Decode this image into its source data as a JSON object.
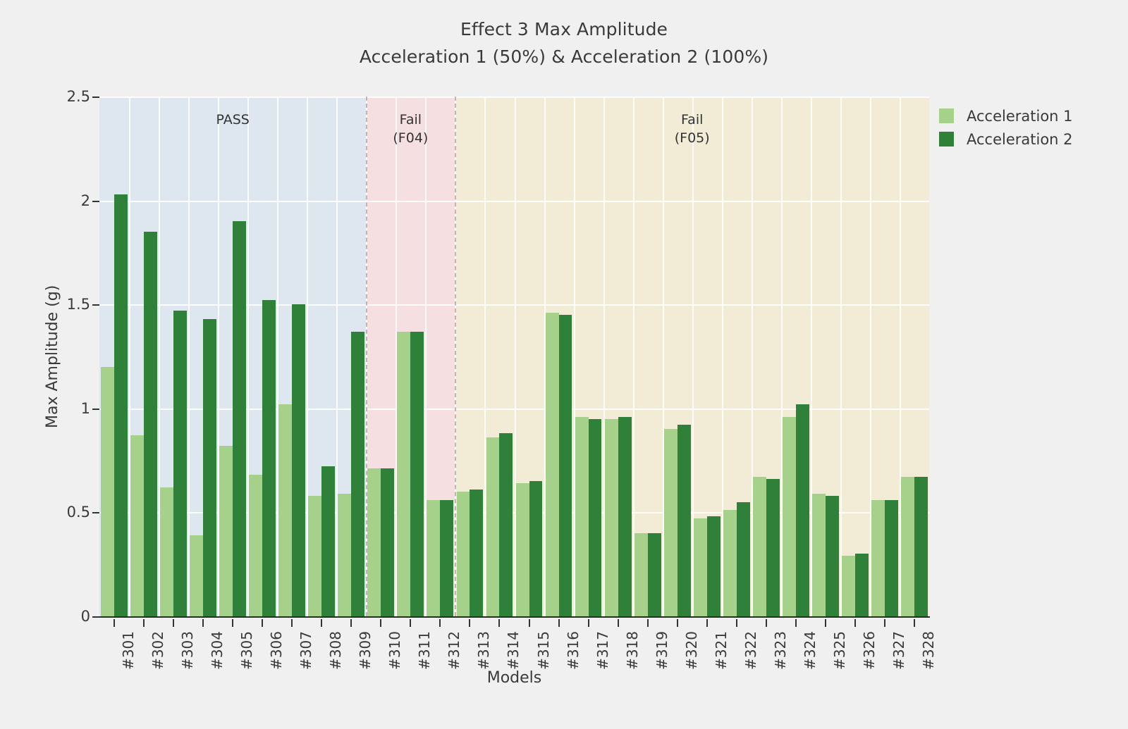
{
  "chart_data": {
    "type": "bar",
    "title": "Effect 3 Max Amplitude",
    "subtitle": "Acceleration 1 (50%) & Acceleration 2 (100%)",
    "xlabel": "Models",
    "ylabel": "Max Amplitude (g)",
    "ylim": [
      0,
      2.5
    ],
    "yticks": [
      0,
      0.5,
      1,
      1.5,
      2,
      2.5
    ],
    "ytick_labels": [
      "0",
      "0.5",
      "1",
      "1.5",
      "2",
      "2.5"
    ],
    "grid": true,
    "legend_position": "right",
    "categories": [
      "#301",
      "#302",
      "#303",
      "#304",
      "#305",
      "#306",
      "#307",
      "#308",
      "#309",
      "#310",
      "#311",
      "#312",
      "#313",
      "#314",
      "#315",
      "#316",
      "#317",
      "#318",
      "#319",
      "#320",
      "#321",
      "#322",
      "#323",
      "#324",
      "#325",
      "#326",
      "#327",
      "#328"
    ],
    "series": [
      {
        "name": "Acceleration 1",
        "color": "#a6d18a",
        "values": [
          1.2,
          0.87,
          0.62,
          0.39,
          0.82,
          0.68,
          1.02,
          0.58,
          0.59,
          0.71,
          1.37,
          0.56,
          0.6,
          0.86,
          0.64,
          1.46,
          0.96,
          0.95,
          0.4,
          0.9,
          0.47,
          0.51,
          0.67,
          0.96,
          0.59,
          0.29,
          0.56,
          0.67
        ]
      },
      {
        "name": "Acceleration 2",
        "color": "#2f8039",
        "values": [
          2.03,
          1.85,
          1.47,
          1.43,
          1.9,
          1.52,
          1.5,
          0.72,
          1.37,
          0.71,
          1.37,
          0.56,
          0.61,
          0.88,
          0.65,
          1.45,
          0.95,
          0.96,
          0.4,
          0.92,
          0.48,
          0.55,
          0.66,
          1.02,
          0.58,
          0.3,
          0.56,
          0.67
        ]
      }
    ],
    "zones": [
      {
        "label": "PASS",
        "start_index": 0,
        "end_index": 9,
        "color": "#dee6ef"
      },
      {
        "label": "Fail\n(F04)",
        "start_index": 9,
        "end_index": 12,
        "color": "#f5dfe0"
      },
      {
        "label": "Fail\n(F05)",
        "start_index": 12,
        "end_index": 28,
        "color": "#f2ecd7"
      }
    ]
  },
  "legend": {
    "items": [
      {
        "label": "Acceleration 1",
        "color": "#a6d18a"
      },
      {
        "label": "Acceleration 2",
        "color": "#2f8039"
      }
    ]
  }
}
